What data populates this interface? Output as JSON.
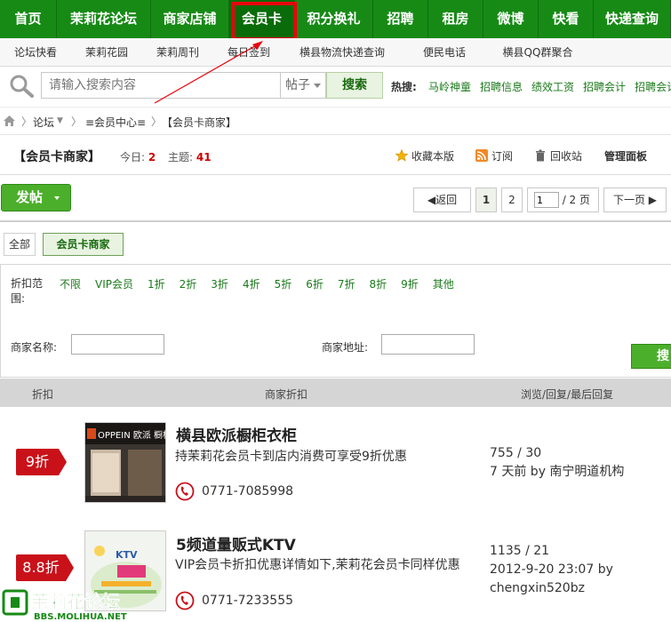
{
  "nav": {
    "items": [
      {
        "label": "首页",
        "width": 64
      },
      {
        "label": "茉莉花论坛",
        "width": 106
      },
      {
        "label": "商家店铺",
        "width": 88
      },
      {
        "label": "会员卡",
        "width": 74
      },
      {
        "label": "积分换礼",
        "width": 88
      },
      {
        "label": "招聘",
        "width": 62
      },
      {
        "label": "租房",
        "width": 62
      },
      {
        "label": "微博",
        "width": 62
      },
      {
        "label": "快看",
        "width": 62
      },
      {
        "label": "快递查询",
        "width": 87
      }
    ],
    "active_index": 3
  },
  "subnav": {
    "items": [
      {
        "label": "论坛快看",
        "width": 80
      },
      {
        "label": "茉莉花园",
        "width": 80
      },
      {
        "label": "茉莉周刊",
        "width": 80
      },
      {
        "label": "每日签到",
        "width": 80
      },
      {
        "label": "横县物流快递查询",
        "width": 130
      },
      {
        "label": "便民电话",
        "width": 100
      },
      {
        "label": "横县QQ群聚合",
        "width": 110
      }
    ]
  },
  "search": {
    "placeholder": "请输入搜索内容",
    "type": "帖子",
    "button": "搜索",
    "hot_label": "热搜:",
    "hot_links": [
      "马岭神童",
      "招聘信息",
      "绩效工资",
      "招聘会计",
      "招聘会计"
    ]
  },
  "breadcrumb": {
    "forum": "论坛",
    "member_center": "≡会员中心≡",
    "current": "【会员卡商家】"
  },
  "board": {
    "title": "【会员卡商家】",
    "today_label": "今日:",
    "today": "2",
    "topics_label": "主题:",
    "topics": "41",
    "favorite": "收藏本版",
    "subscribe": "订阅",
    "recycle": "回收站",
    "admin": "管理面板"
  },
  "toolbar": {
    "post_label": "发帖",
    "back_label": "◀返回",
    "page1": "1",
    "page2": "2",
    "page_input": "1",
    "page_total": "/ 2 页",
    "next_label": "下一页 ▶"
  },
  "filter_tabs": [
    "全部",
    "会员卡商家"
  ],
  "discount": {
    "label": "折扣范围:",
    "options": [
      "不限",
      "VIP会员",
      "1折",
      "2折",
      "3折",
      "4折",
      "5折",
      "6折",
      "7折",
      "8折",
      "9折",
      "其他"
    ],
    "name_label": "商家名称:",
    "address_label": "商家地址:",
    "search_button": "搜索"
  },
  "table": {
    "headers": {
      "discount": "折扣",
      "shop": "商家折扣",
      "stats": "浏览/回复/最后回复"
    },
    "rows": [
      {
        "badge": "9折",
        "name": "横县欧派橱柜衣柜",
        "desc": "持茉莉花会员卡到店内消费可享受9折优惠",
        "phone": "0771-7085998",
        "views_replies": "755 / 30",
        "last_reply": "7 天前  by 南宁明道机构",
        "last_reply_2": ""
      },
      {
        "badge": "8.8折",
        "name": "5频道量贩式KTV",
        "desc": "VIP会员卡折扣优惠详情如下,茉莉花会员卡同样优惠",
        "phone": "0771-7233555",
        "views_replies": "1135 / 21",
        "last_reply": "2012-9-20 23:07 by",
        "last_reply_2": "chengxin520bz"
      }
    ]
  },
  "thumbs": {
    "oppein_sign": "OPPEIN 欧派 橱柜",
    "ktv_sign": "KTV"
  },
  "watermark": {
    "name": "茉莉花论坛",
    "url": "BBS.MOLIHUA.NET"
  }
}
